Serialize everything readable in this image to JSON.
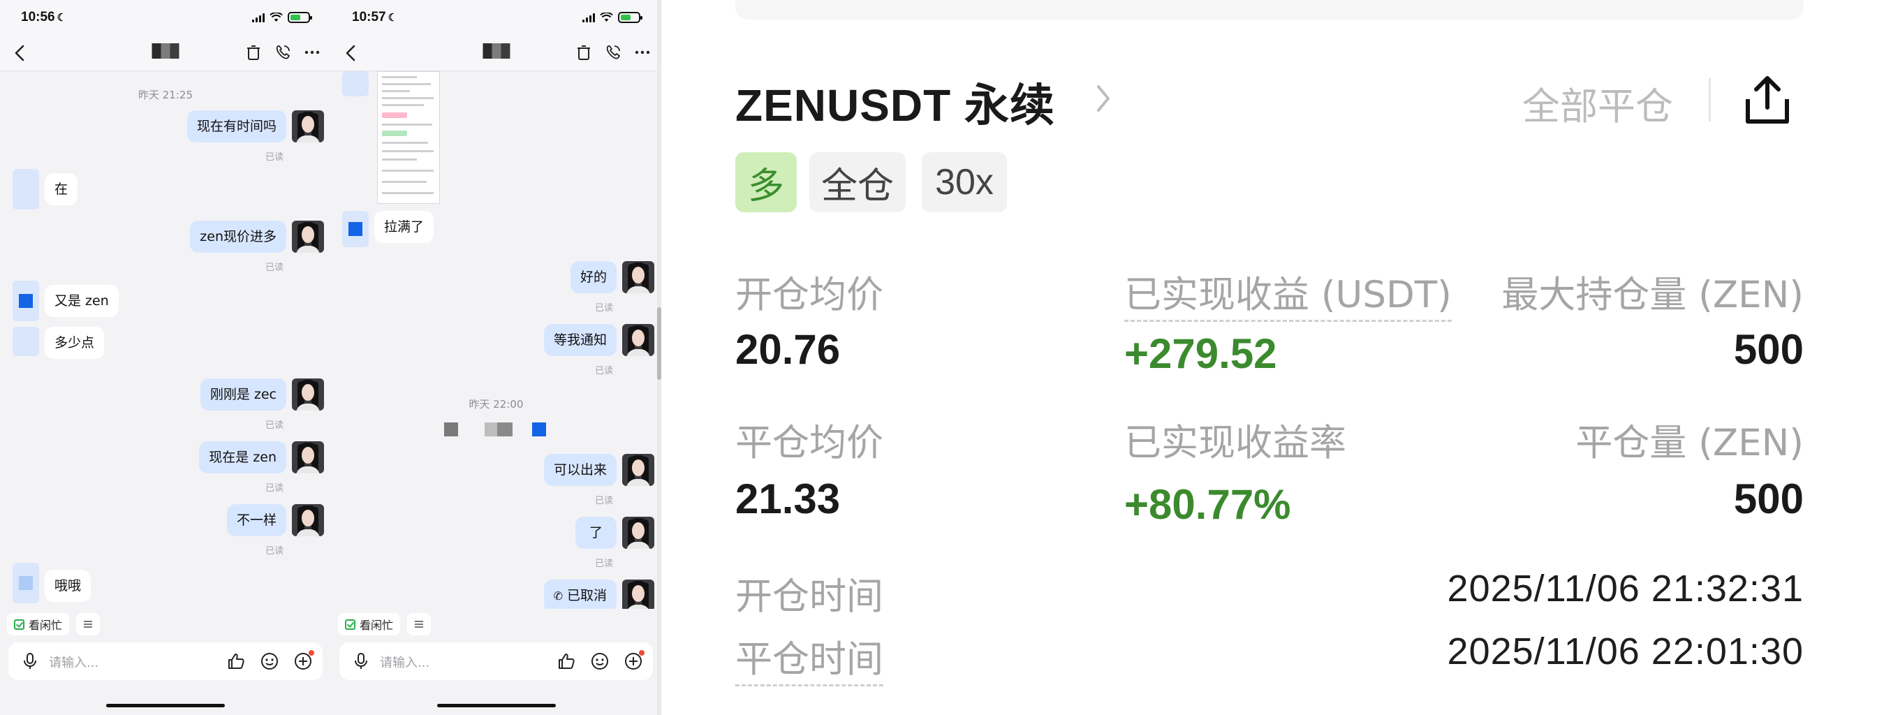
{
  "left_phone": {
    "status_time": "10:56",
    "messages": {
      "ts1": "昨天 21:25",
      "m1": "现在有时间吗",
      "m2": "在",
      "m3": "zen现价进多",
      "m4": "又是 zen",
      "m5": "多少点",
      "m6": "刚刚是 zec",
      "m7": "现在是 zen",
      "m8": "不一样",
      "m9": "哦哦"
    },
    "read_label": "已读",
    "quick_chip": "看闲忙",
    "input_placeholder": "请输入..."
  },
  "right_phone": {
    "status_time": "10:57",
    "messages": {
      "m1": "拉满了",
      "m2": "好的",
      "m3": "等我通知",
      "ts1": "昨天 22:00",
      "m4": "可以出来",
      "m5": "了",
      "m6": "已取消"
    },
    "read_label": "已读",
    "quick_chip": "看闲忙",
    "input_placeholder": "请输入..."
  },
  "order": {
    "title": "ZENUSDT 永续",
    "close_all": "全部平仓",
    "tags": {
      "side": "多",
      "margin": "全仓",
      "leverage": "30x"
    },
    "labels": {
      "open_avg": "开仓均价",
      "realized_pnl": "已实现收益 (USDT)",
      "max_pos": "最大持仓量 (ZEN)",
      "close_avg": "平仓均价",
      "realized_rate": "已实现收益率",
      "close_qty": "平仓量 (ZEN)",
      "open_time": "开仓时间",
      "close_time": "平仓时间"
    },
    "values": {
      "open_avg": "20.76",
      "realized_pnl": "+279.52",
      "max_pos": "500",
      "close_avg": "21.33",
      "realized_rate": "+80.77%",
      "close_qty": "500",
      "open_time": "2025/11/06 21:32:31",
      "close_time": "2025/11/06 22:01:30"
    },
    "colors": {
      "profit": "#3c8a2e",
      "long_tag_bg": "#cfeeb9"
    }
  },
  "icons": [
    "back-icon",
    "trash-icon",
    "phone-icon",
    "more-icon",
    "mic-icon",
    "thumbs-up-icon",
    "smile-icon",
    "plus-icon",
    "share-icon",
    "chevron-right-icon"
  ]
}
